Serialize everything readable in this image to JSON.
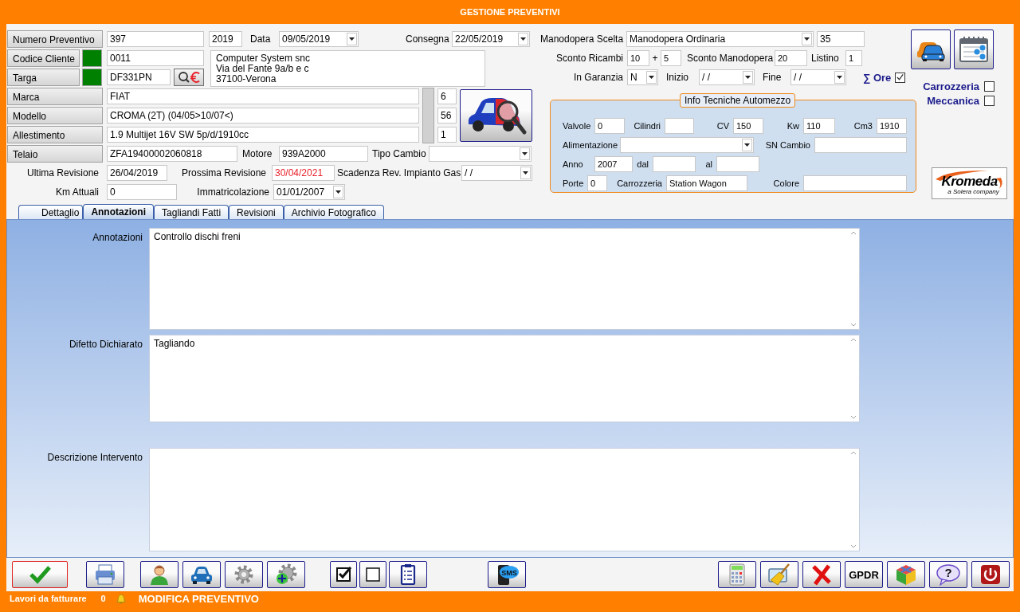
{
  "window": {
    "title": "GESTIONE PREVENTIVI"
  },
  "header": {
    "numero": {
      "button": "Numero Preventivo",
      "value": "397",
      "year": "2019"
    },
    "data": {
      "label": "Data",
      "value": "09/05/2019"
    },
    "consegna": {
      "label": "Consegna",
      "value": "22/05/2019"
    },
    "cliente": {
      "button": "Codice Cliente",
      "value": "0011",
      "address": [
        "Computer System snc",
        "Via del Fante 9a/b e c",
        "37100-Verona"
      ]
    },
    "targa": {
      "button": "Targa",
      "value": "DF331PN"
    },
    "vehicle_rows": [
      {
        "button": "Marca",
        "value": "FIAT",
        "code": "6"
      },
      {
        "button": "Modello",
        "value": "CROMA (2T) (04/05>10/07<)",
        "code": "56"
      },
      {
        "button": "Allestimento",
        "value": "1.9 Multijet 16V SW 5p/d/1910cc",
        "code": "1"
      }
    ],
    "telaio": {
      "button": "Telaio",
      "value": "ZFA19400002060818"
    },
    "motore": {
      "label": "Motore",
      "value": "939A2000"
    },
    "tipo_cambio": {
      "label": "Tipo Cambio"
    },
    "ultima_revisione": {
      "label": "Ultima Revisione",
      "value": "26/04/2019"
    },
    "prossima_revisione": {
      "label": "Prossima Revisione",
      "value": "30/04/2021"
    },
    "scadenza_gas": {
      "label": "Scadenza Rev. Impianto Gas",
      "value": "/ /"
    },
    "km": {
      "label": "Km Attuali",
      "value": "0"
    },
    "immatricolazione": {
      "label": "Immatricolazione",
      "value": "01/01/2007"
    }
  },
  "manodopera": {
    "label": "Manodopera Scelta",
    "value": "Manodopera Ordinaria",
    "rate": "35"
  },
  "sconti": {
    "ricambi_label": "Sconto Ricambi",
    "ricambi_1": "10",
    "plus": "+",
    "ricambi_2": "5",
    "manodopera_label": "Sconto Manodopera",
    "manodopera": "20",
    "listino_label": "Listino",
    "listino": "1"
  },
  "garanzia": {
    "label": "In Garanzia",
    "value": "N",
    "inizio_label": "Inizio",
    "inizio": "/ /",
    "fine_label": "Fine",
    "fine": "/ /"
  },
  "ore": {
    "label": "∑ Ore",
    "checked": true
  },
  "flags": [
    {
      "label": "Carrozzeria",
      "checked": false
    },
    {
      "label": "Meccanica",
      "checked": false
    }
  ],
  "info_tecniche": {
    "title": "Info Tecniche Automezzo",
    "valvole": {
      "label": "Valvole",
      "value": "0",
      "kind": "input"
    },
    "cilindri": {
      "label": "Cilindri",
      "kind": "input"
    },
    "cv": {
      "label": "CV",
      "value": "150",
      "kind": "input"
    },
    "kw": {
      "label": "Kw",
      "value": "110",
      "kind": "input"
    },
    "cm3": {
      "label": "Cm3",
      "value": "1910",
      "kind": "input"
    },
    "alimentazione": {
      "label": "Alimentazione",
      "kind": "combo"
    },
    "sn_cambio": {
      "label": "SN Cambio",
      "kind": "input"
    },
    "anno": {
      "label": "Anno",
      "value": "2007",
      "kind": "input"
    },
    "dal": {
      "label": "dal",
      "kind": "input"
    },
    "al": {
      "label": "al",
      "kind": "input"
    },
    "porte": {
      "label": "Porte",
      "value": "0",
      "kind": "input"
    },
    "carrozzeria": {
      "label": "Carrozzeria",
      "value": "Station Wagon",
      "kind": "input"
    },
    "colore": {
      "label": "Colore",
      "kind": "input"
    }
  },
  "logo": {
    "name": "Kromeda",
    "tagline": "a Solera company"
  },
  "tabs": [
    {
      "label": "Dettaglio",
      "selected": false
    },
    {
      "label": "Annotazioni",
      "selected": true
    },
    {
      "label": "Tagliandi Fatti",
      "selected": false
    },
    {
      "label": "Revisioni",
      "selected": false
    },
    {
      "label": "Archivio Fotografico",
      "selected": false
    }
  ],
  "notes": [
    {
      "label": "Annotazioni",
      "value": "Controllo dischi freni"
    },
    {
      "label": "Difetto Dichiarato",
      "value": "Tagliando"
    },
    {
      "label": "Descrizione Intervento"
    }
  ],
  "toolbar": {
    "sms_label": "SMS",
    "gpdr": "GPDR",
    "help_label": "?"
  },
  "status_bar": {
    "label": "Lavori da fatturare",
    "count": "0",
    "mode": "MODIFICA PREVENTIVO"
  }
}
